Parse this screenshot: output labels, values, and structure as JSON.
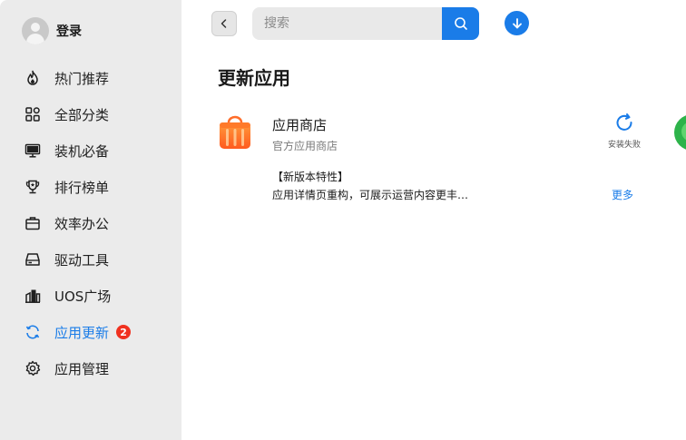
{
  "user": {
    "login_label": "登录"
  },
  "sidebar": {
    "items": [
      {
        "label": "热门推荐",
        "icon": "flame-icon"
      },
      {
        "label": "全部分类",
        "icon": "grid-icon"
      },
      {
        "label": "装机必备",
        "icon": "monitor-icon"
      },
      {
        "label": "排行榜单",
        "icon": "trophy-icon"
      },
      {
        "label": "效率办公",
        "icon": "briefcase-icon"
      },
      {
        "label": "驱动工具",
        "icon": "drive-icon"
      },
      {
        "label": "UOS广场",
        "icon": "buildings-icon"
      },
      {
        "label": "应用更新",
        "icon": "refresh-icon",
        "badge": "2",
        "active": true
      },
      {
        "label": "应用管理",
        "icon": "gear-icon"
      }
    ]
  },
  "search": {
    "placeholder": "搜索"
  },
  "page": {
    "title": "更新应用"
  },
  "app": {
    "name": "应用商店",
    "subtitle": "官方应用商店",
    "status_label": "安装失败",
    "feature_title": "【新版本特性】",
    "feature_desc": "应用详情页重构，可展示运营内容更丰…",
    "more_label": "更多"
  },
  "colors": {
    "accent": "#1a7ce8",
    "badge": "#f0311f",
    "sidebar_bg": "#ebebeb"
  }
}
